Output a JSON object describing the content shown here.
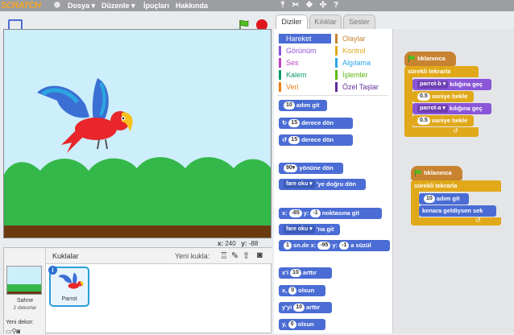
{
  "app": {
    "logo": "SCRATCH"
  },
  "menu": {
    "file": "Dosya",
    "edit": "Düzenle",
    "tips": "İpuçları",
    "about": "Hakkında"
  },
  "stage": {
    "version": "v461",
    "x_label": "x:",
    "x_value": "240",
    "y_label": "y:",
    "y_value": "-88"
  },
  "sprites": {
    "title": "Kuklalar",
    "new_sprite": "Yeni kukla:",
    "stage_label": "Sahne",
    "stage_count": "2 dekorlar",
    "new_backdrop": "Yeni dekor:",
    "sprite_name": "Parrot"
  },
  "tabs": {
    "scripts": "Diziler",
    "costumes": "Kılıklar",
    "sounds": "Sesler"
  },
  "categories": {
    "motion": "Hareket",
    "looks": "Görünüm",
    "sound": "Ses",
    "pen": "Kalem",
    "data": "Veri",
    "events": "Olaylar",
    "control": "Kontrol",
    "sensing": "Algılama",
    "operators": "İşlemler",
    "more": "Özel Taşlar"
  },
  "palette": {
    "move_val": "10",
    "move_text": "adım git",
    "turn_r_val": "15",
    "turn_r_text": "derece dön",
    "turn_l_val": "15",
    "turn_l_text": "derece dön",
    "point_val": "90",
    "point_text": "yönüne dön",
    "towards_val": "fare oku",
    "towards_text": "'ye doğru dön",
    "goto_x_label": "x:",
    "goto_x": "-85",
    "goto_y_label": "y:",
    "goto_y": "-1",
    "goto_text": "noktasına git",
    "goto2_val": "fare oku",
    "goto2_text": "'na git",
    "glide_secs": "1",
    "glide_label1": "sn.de x:",
    "glide_x": "-95",
    "glide_y_label": "y:",
    "glide_y": "-1",
    "glide_text": "a süzül",
    "chx_label": "x'i",
    "chx_val": "10",
    "chx_text": "arttır",
    "setx_label": "x,",
    "setx_val": "0",
    "setx_text": "olsun",
    "chy_label": "y'yi",
    "chy_val": "10",
    "chy_text": "arttır",
    "sety_label": "y,",
    "sety_val": "0",
    "sety_text": "olsun"
  },
  "script1": {
    "hat": "tıklanınca",
    "forever": "sürekli tekrarla",
    "c1_val": "parrot-b",
    "c1_text": "kılığına geç",
    "w1_val": "0.5",
    "w1_text": "saniye bekle",
    "c2_val": "parrot-a",
    "c2_text": "kılığına geç",
    "w2_val": "0.5",
    "w2_text": "saniye bekle"
  },
  "script2": {
    "hat": "tıklanınca",
    "forever": "sürekli tekrarla",
    "move_val": "10",
    "move_text": "adım git",
    "bounce": "kenara geldiysen sek"
  },
  "colors": {
    "motion": "#4a6cd4",
    "looks": "#8a55d7",
    "control": "#e1a91a",
    "events": "#c88330",
    "sound": "#bb42c3",
    "pen": "#0e9a6c",
    "data": "#ee7d16",
    "sensing": "#2ca5e2",
    "operators": "#5cb712",
    "more": "#632d99"
  }
}
